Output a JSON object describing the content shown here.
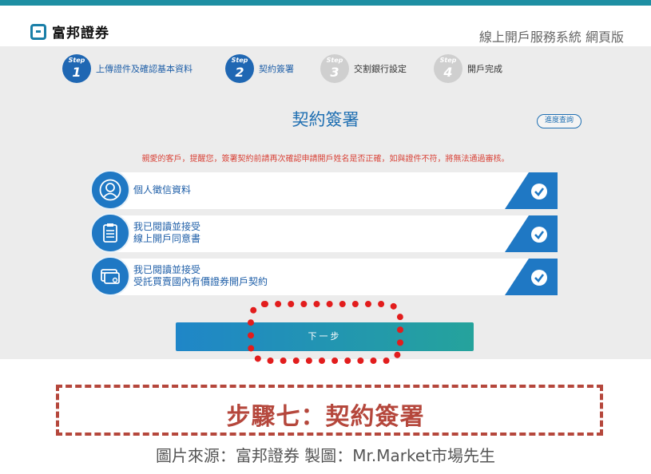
{
  "header": {
    "brand": "富邦證券",
    "system_title": "線上開戶服務系統 網頁版"
  },
  "steps": [
    {
      "word": "Step",
      "num": "1",
      "label": "上傳證件及確認基本資料",
      "active": true
    },
    {
      "word": "Step",
      "num": "2",
      "label": "契約簽署",
      "active": true
    },
    {
      "word": "Step",
      "num": "3",
      "label": "交割銀行設定",
      "active": false
    },
    {
      "word": "Step",
      "num": "4",
      "label": "開戶完成",
      "active": false
    }
  ],
  "main": {
    "title": "契約簽署",
    "progress_button": "進度查詢",
    "notice": "親愛的客戶，提醒您，簽署契約前請再次確認申請開戶姓名是否正確，如與證件不符，將無法通過審核。",
    "agreements": [
      {
        "line1": "個人徵信資料",
        "line2": "",
        "icon": "person-icon"
      },
      {
        "line1": "我已閱讀並接受",
        "line2": "線上開戶同意書",
        "icon": "clipboard-icon"
      },
      {
        "line1": "我已閱讀並接受",
        "line2": "受託買賣國內有價證券開戶契約",
        "icon": "card-icon"
      }
    ],
    "next_button": "下一步"
  },
  "caption": {
    "step_title": "步驟七：契約簽署",
    "source": "圖片來源：富邦證券 製圖：Mr.Market市場先生"
  },
  "colors": {
    "brand_blue": "#1f6fb2",
    "teal": "#1e8fa3",
    "alert_red": "#d9453a",
    "highlight_red": "#e21d1d",
    "caption_red": "#b5473c"
  }
}
